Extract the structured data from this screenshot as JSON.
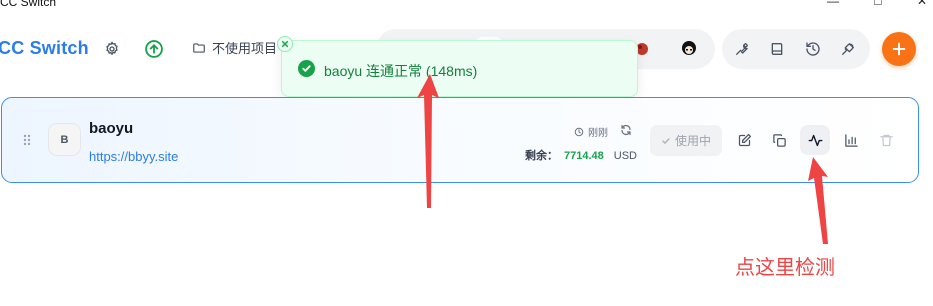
{
  "window": {
    "title": "CC Switch",
    "minimize_glyph": "—",
    "maximize_glyph": "□",
    "close_glyph": "✕"
  },
  "header": {
    "app_title": "CC Switch",
    "unused_label": "不使用项目",
    "settings_icon": "gear-icon",
    "update_icon": "arrow-up-circle-icon",
    "folder_icon": "folder-icon"
  },
  "toolbar": {
    "tools": [
      "wrench-icon",
      "book-icon",
      "history-icon",
      "plug-icon"
    ],
    "add_icon": "plus-icon"
  },
  "toast": {
    "message": "baoyu 连通正常 (148ms)",
    "icon": "check-circle-icon"
  },
  "provider": {
    "initial": "B",
    "name": "baoyu",
    "url": "https://bbyy.site",
    "updated": "刚刚",
    "balance_label": "剩余：",
    "balance_value": "7714.48",
    "currency": "USD",
    "in_use_label": "使用中",
    "actions": [
      "edit-icon",
      "copy-icon",
      "activity-icon",
      "bar-chart-icon",
      "trash-icon"
    ]
  },
  "annotation": {
    "text": "点这里检测"
  },
  "colors": {
    "accent": "#2b7de9",
    "success": "#16a34a",
    "add_button": "#f97316",
    "annotation": "#ef4444"
  }
}
